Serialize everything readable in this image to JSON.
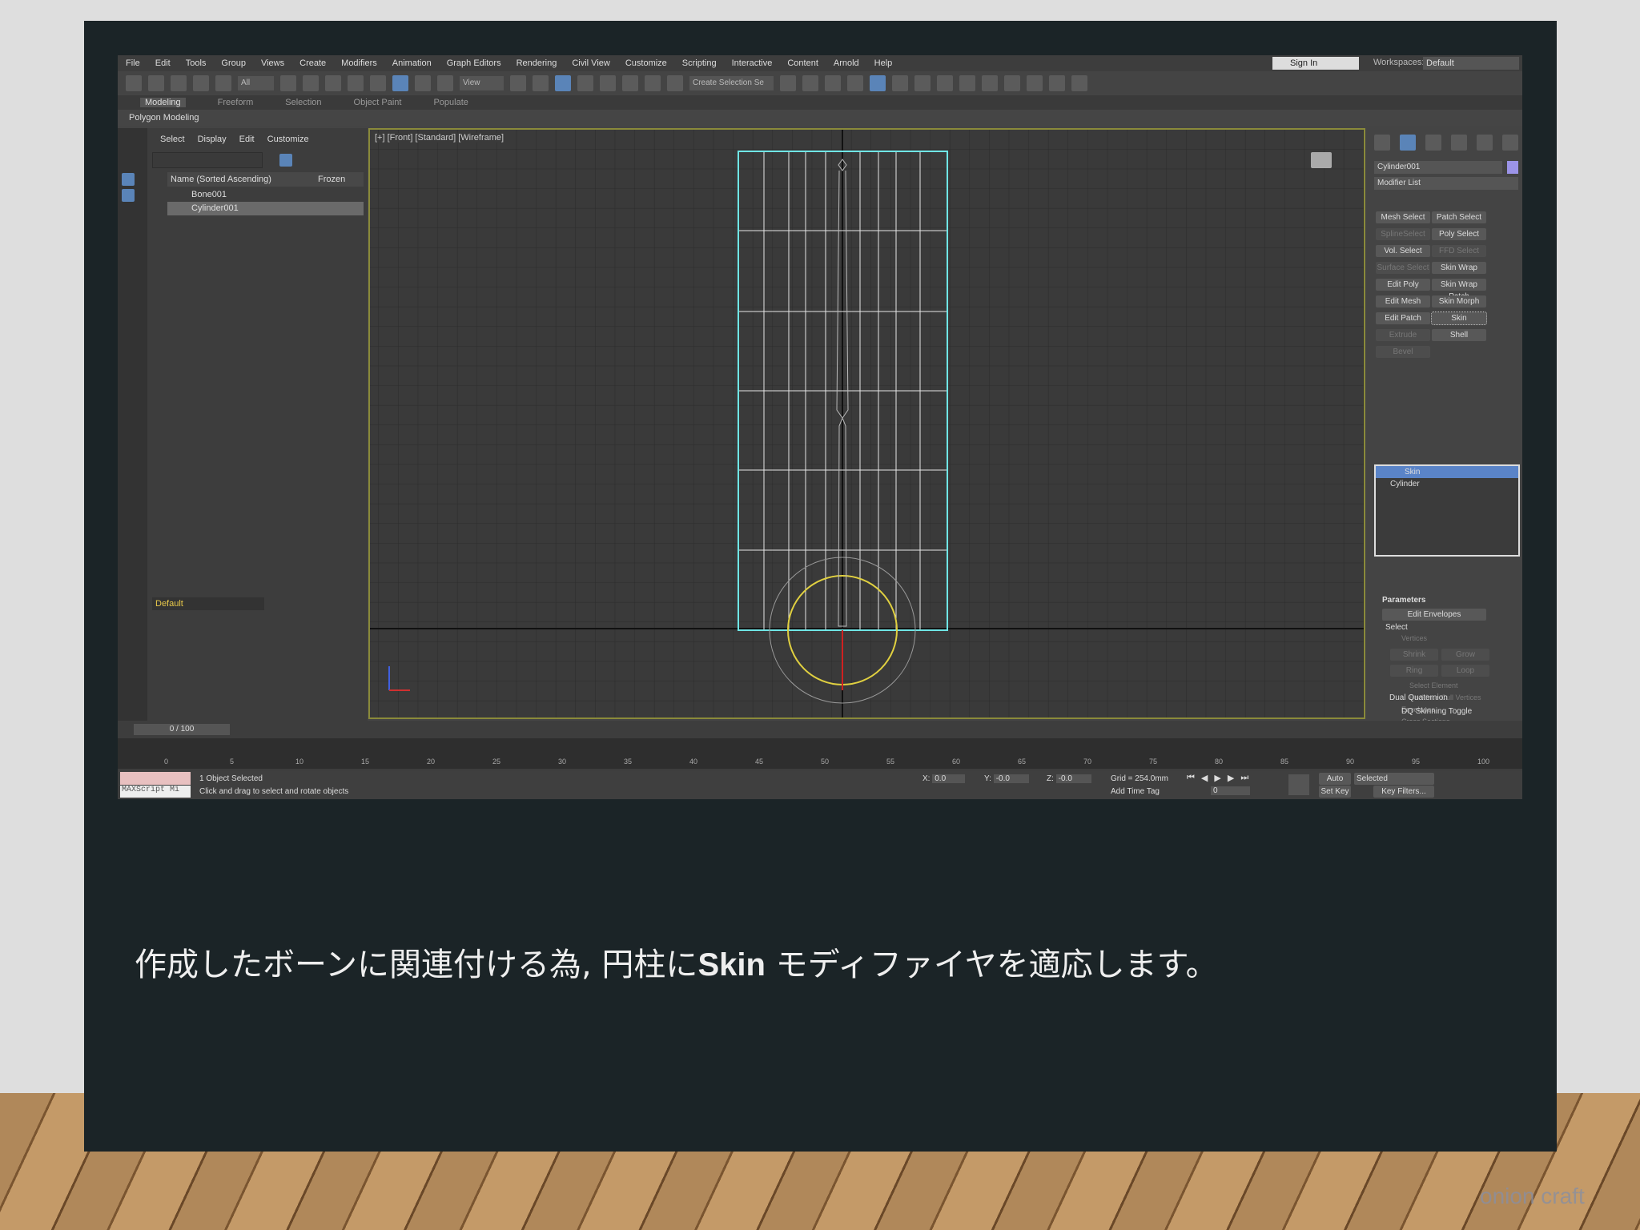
{
  "menu": [
    "File",
    "Edit",
    "Tools",
    "Group",
    "Views",
    "Create",
    "Modifiers",
    "Animation",
    "Graph Editors",
    "Rendering",
    "Civil View",
    "Customize",
    "Scripting",
    "Interactive",
    "Content",
    "Arnold",
    "Help"
  ],
  "sign_in": "Sign In",
  "workspaces_label": "Workspaces:",
  "workspace": "Default",
  "toolbar": {
    "filter": "All",
    "view": "View",
    "selection_set": "Create Selection Se"
  },
  "ribbon": [
    "Modeling",
    "Freeform",
    "Selection",
    "Object Paint",
    "Populate"
  ],
  "ribbon_panel": "Polygon Modeling",
  "explorer": {
    "menu": [
      "Select",
      "Display",
      "Edit",
      "Customize"
    ],
    "col_name": "Name (Sorted Ascending)",
    "col_frozen": "Frozen",
    "rows": [
      "Bone001",
      "Cylinder001"
    ],
    "layer": "Default"
  },
  "viewport": {
    "label": "[+] [Front] [Standard] [Wireframe]"
  },
  "command": {
    "object_name": "Cylinder001",
    "object_color": "#9c94e8",
    "modifier_list": "Modifier List",
    "buttons": [
      [
        "Mesh Select",
        true
      ],
      [
        "Patch Select",
        true
      ],
      [
        "SplineSelect",
        false
      ],
      [
        "Poly Select",
        true
      ],
      [
        "Vol. Select",
        true
      ],
      [
        "FFD Select",
        false
      ],
      [
        "Surface Select",
        false
      ],
      [
        "Skin Wrap",
        true
      ],
      [
        "Edit Poly",
        true
      ],
      [
        "Skin Wrap Patch",
        true
      ],
      [
        "Edit Mesh",
        true
      ],
      [
        "Skin Morph",
        true
      ],
      [
        "Edit Patch",
        true
      ],
      [
        "Skin",
        true
      ],
      [
        "Extrude",
        false
      ],
      [
        "Shell",
        true
      ],
      [
        "Bevel",
        false
      ]
    ],
    "stack": [
      "Skin",
      "Cylinder"
    ],
    "rollout": "Parameters",
    "edit_envelopes": "Edit Envelopes",
    "select_group": "Select",
    "vertices": "Vertices",
    "shrink": "Shrink",
    "grow": "Grow",
    "ring": "Ring",
    "loop": "Loop",
    "select_element": "Select Element",
    "backface": "Backface Cull Vertices",
    "envelopes": "Envelopes",
    "cross_sections": "Cross Sections",
    "dq_group": "Dual Quaternion",
    "dq_toggle": "DQ Skinning Toggle"
  },
  "timeline": {
    "frame": "0 / 100",
    "ticks": [
      "0",
      "5",
      "10",
      "15",
      "20",
      "25",
      "30",
      "35",
      "40",
      "45",
      "50",
      "55",
      "60",
      "65",
      "70",
      "75",
      "80",
      "85",
      "90",
      "95",
      "100"
    ]
  },
  "status": {
    "selected": "1 Object Selected",
    "prompt": "Click and drag to select and rotate objects",
    "maxscript": "MAXScript Mi",
    "x": "0.0",
    "y": "-0.0",
    "z": "-0.0",
    "grid": "Grid = 254.0mm",
    "add_time_tag": "Add Time Tag",
    "auto_key": "Auto Key",
    "set_key": "Set Key",
    "key_mode": "Selected",
    "key_filters": "Key Filters...",
    "frame": "0"
  },
  "caption": {
    "pre": "作成したボーンに関連付ける為, 円柱に",
    "skin": "Skin",
    "post": " モディファイヤを適応します。"
  },
  "watermark": "onion craft"
}
